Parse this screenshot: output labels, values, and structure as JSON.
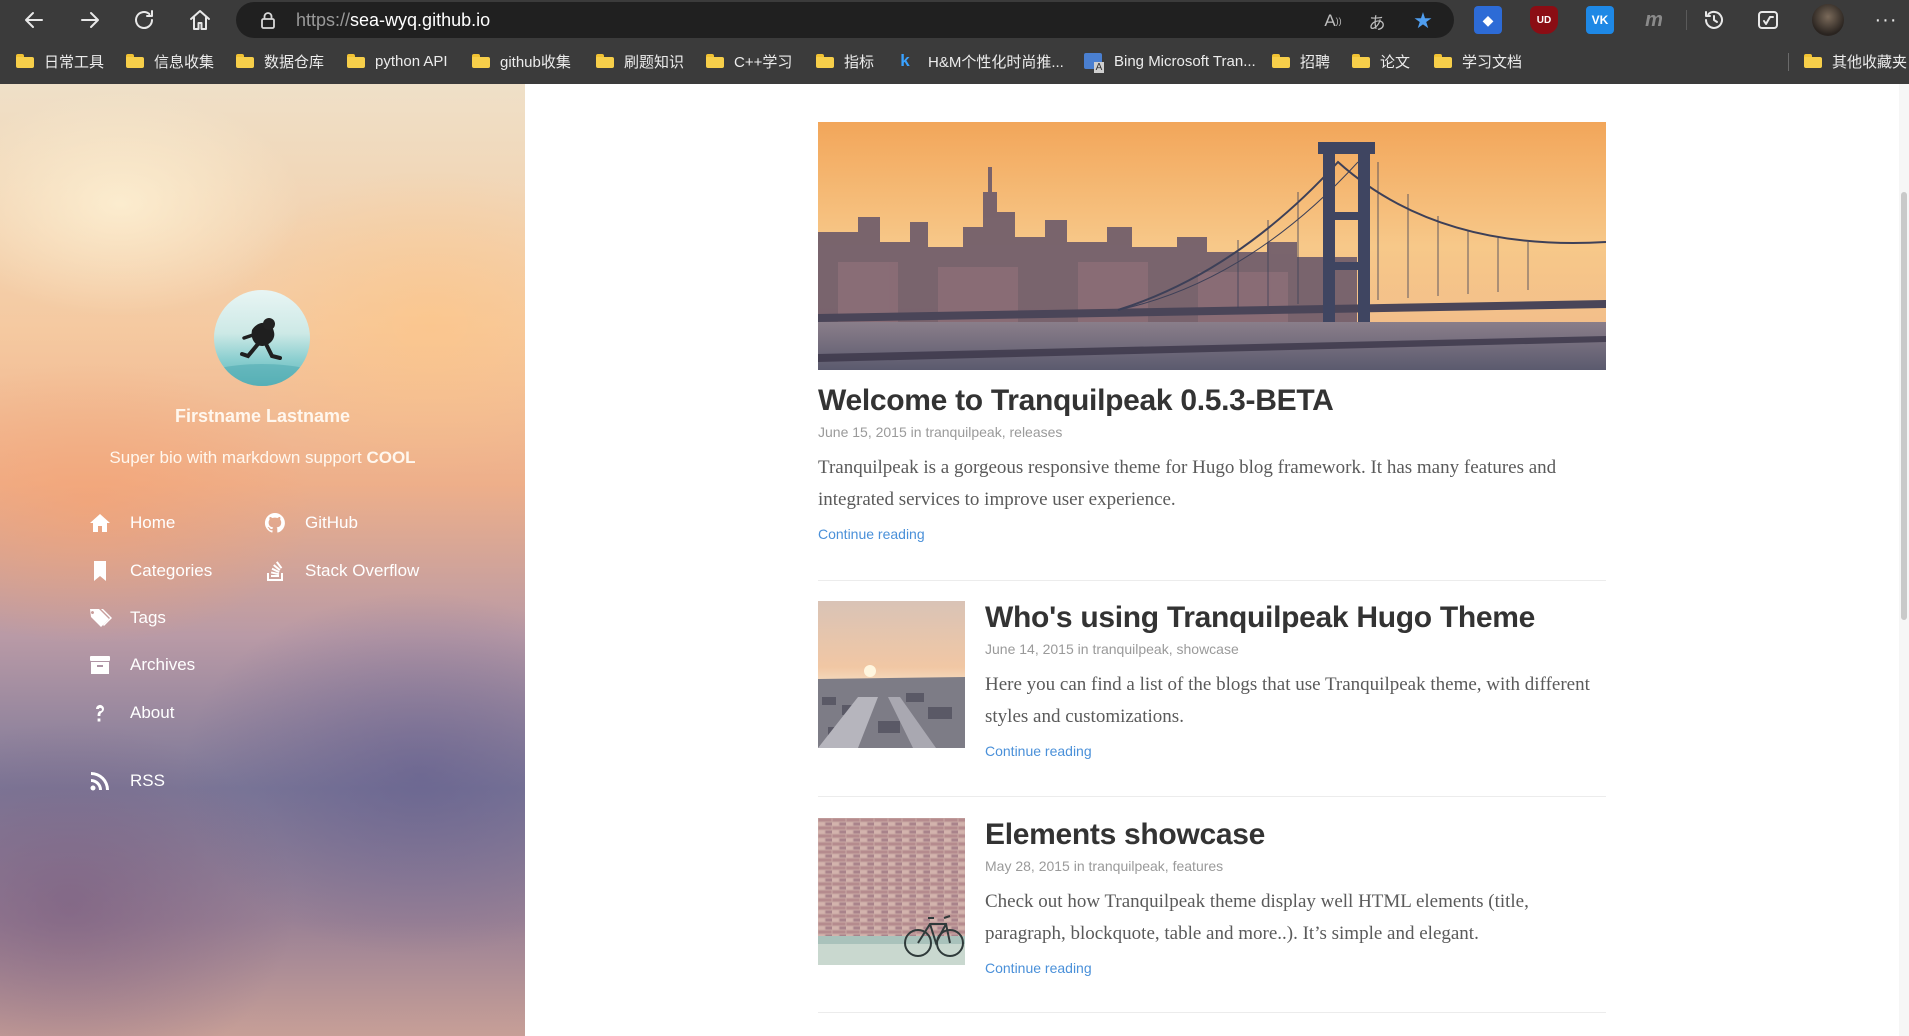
{
  "browser": {
    "url_protocol": "https://",
    "url_host": "sea-wyq.github.io",
    "bookmarks": [
      {
        "label": "日常工具",
        "icon": "folder-icon"
      },
      {
        "label": "信息收集",
        "icon": "folder-icon"
      },
      {
        "label": "数据仓库",
        "icon": "folder-icon"
      },
      {
        "label": "python API",
        "icon": "folder-icon"
      },
      {
        "label": "github收集",
        "icon": "folder-icon"
      },
      {
        "label": "刷题知识",
        "icon": "folder-icon"
      },
      {
        "label": "C++学习",
        "icon": "folder-icon"
      },
      {
        "label": "指标",
        "icon": "folder-icon"
      },
      {
        "label": "H&M个性化时尚推...",
        "icon": "k-site-icon"
      },
      {
        "label": "Bing Microsoft Tran...",
        "icon": "translator-icon"
      },
      {
        "label": "招聘",
        "icon": "folder-icon"
      },
      {
        "label": "论文",
        "icon": "folder-icon"
      },
      {
        "label": "学习文档",
        "icon": "folder-icon"
      },
      {
        "label": "其他收藏夹",
        "icon": "folder-icon"
      }
    ],
    "read_aloud_glyph": "A",
    "translate_glyph": "あ",
    "more_glyph": "···",
    "extensions": {
      "ublock_glyph": "UD",
      "vk_glyph": "VK",
      "m_glyph": "m"
    }
  },
  "sidebar": {
    "author": "Firstname Lastname",
    "bio_prefix": "Super bio with markdown support ",
    "bio_bold": "COOL",
    "nav_left": [
      {
        "label": "Home",
        "icon": "home-icon"
      },
      {
        "label": "Categories",
        "icon": "bookmark-icon"
      },
      {
        "label": "Tags",
        "icon": "tags-icon"
      },
      {
        "label": "Archives",
        "icon": "archive-icon"
      },
      {
        "label": "About",
        "icon": "question-icon"
      },
      {
        "label": "RSS",
        "icon": "rss-icon"
      }
    ],
    "nav_right": [
      {
        "label": "GitHub",
        "icon": "github-icon"
      },
      {
        "label": "Stack Overflow",
        "icon": "stackoverflow-icon"
      }
    ]
  },
  "posts": [
    {
      "title": "Welcome to Tranquilpeak 0.5.3-BETA",
      "date": "June 15, 2015",
      "in_word": "in",
      "categories": "tranquilpeak, releases",
      "excerpt": "Tranquilpeak is a gorgeous responsive theme for Hugo blog framework. It has many features and integrated services to improve user experience.",
      "more": "Continue reading"
    },
    {
      "title": "Who's using Tranquilpeak Hugo Theme",
      "date": "June 14, 2015",
      "in_word": "in",
      "categories": "tranquilpeak, showcase",
      "excerpt": "Here you can find a list of the blogs that use Tranquilpeak theme, with different styles and customizations.",
      "more": "Continue reading"
    },
    {
      "title": "Elements showcase",
      "date": "May 28, 2015",
      "in_word": "in",
      "categories": "tranquilpeak, features",
      "excerpt": "Check out how Tranquilpeak theme display well HTML elements (title, paragraph, blockquote, table and more..). It’s simple and elegant.",
      "more": "Continue reading"
    }
  ],
  "colors": {
    "browser_chrome": "#3b3b3b",
    "url_field": "#202020",
    "link_blue": "#4a90d9",
    "title_text": "#333333"
  }
}
